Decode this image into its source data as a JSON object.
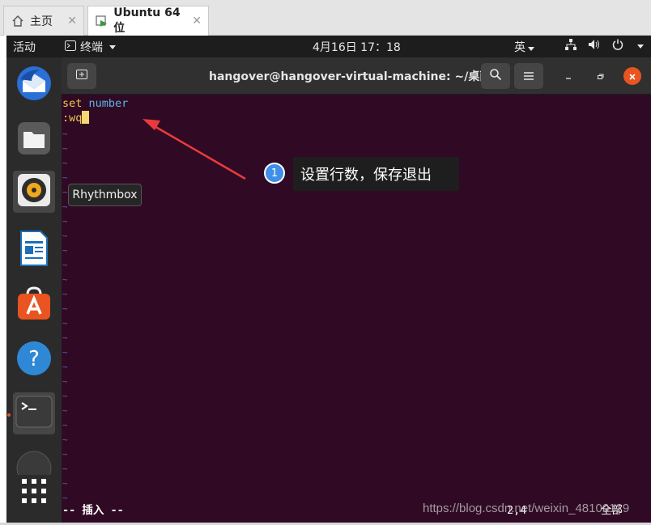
{
  "host": {
    "tabs": [
      {
        "label": "主页",
        "icon": "home-icon"
      },
      {
        "label": "Ubuntu 64 位",
        "icon": "vm-icon"
      }
    ]
  },
  "topbar": {
    "activities": "活动",
    "app_menu": "终端",
    "clock": "4月16日  17：18",
    "input_method": "英"
  },
  "dock": {
    "tooltip": "Rhythmbox",
    "items": [
      "thunderbird-icon",
      "files-icon",
      "rhythmbox-icon",
      "writer-icon",
      "software-icon",
      "help-icon",
      "terminal-icon",
      "disc-icon",
      "app-grid-icon"
    ]
  },
  "terminal": {
    "title": "hangover@hangover-virtual-machine: ~/桌面",
    "line1_set": "set",
    "line1_number": "number",
    "line2_cmd": ":wq",
    "tilde": "~",
    "mode": "-- 插入 --",
    "position": "2,4",
    "scroll": "全部"
  },
  "annotation": {
    "badge": "1",
    "text": "设置行数，保存退出"
  },
  "watermark": "https://blog.csdn.net/weixin_48100129",
  "colors": {
    "terminal_bg": "#300a24",
    "accent": "#e95420",
    "badge": "#3f8ee8"
  }
}
